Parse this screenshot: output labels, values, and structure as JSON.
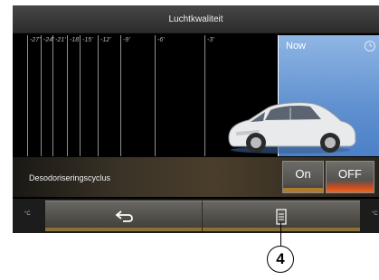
{
  "screen": {
    "title": "Luchtkwaliteit"
  },
  "chart": {
    "ticks": [
      "-27'",
      "-24'",
      "-21'",
      "-18'",
      "-15'",
      "-12'",
      "-9'",
      "-6'",
      "-3'"
    ],
    "now_label": "Now",
    "now_color": "#6f9ad6"
  },
  "deodorizer": {
    "label": "Desodoriseringscyclus",
    "on_label": "On",
    "off_label": "OFF",
    "active": "OFF",
    "active_color": "#f26522"
  },
  "bottom_bar": {
    "unit_left": "°C",
    "unit_right": "°C",
    "back_icon": "back-arrow-icon",
    "menu_icon": "menu-icon"
  },
  "callout": {
    "label": "4"
  }
}
